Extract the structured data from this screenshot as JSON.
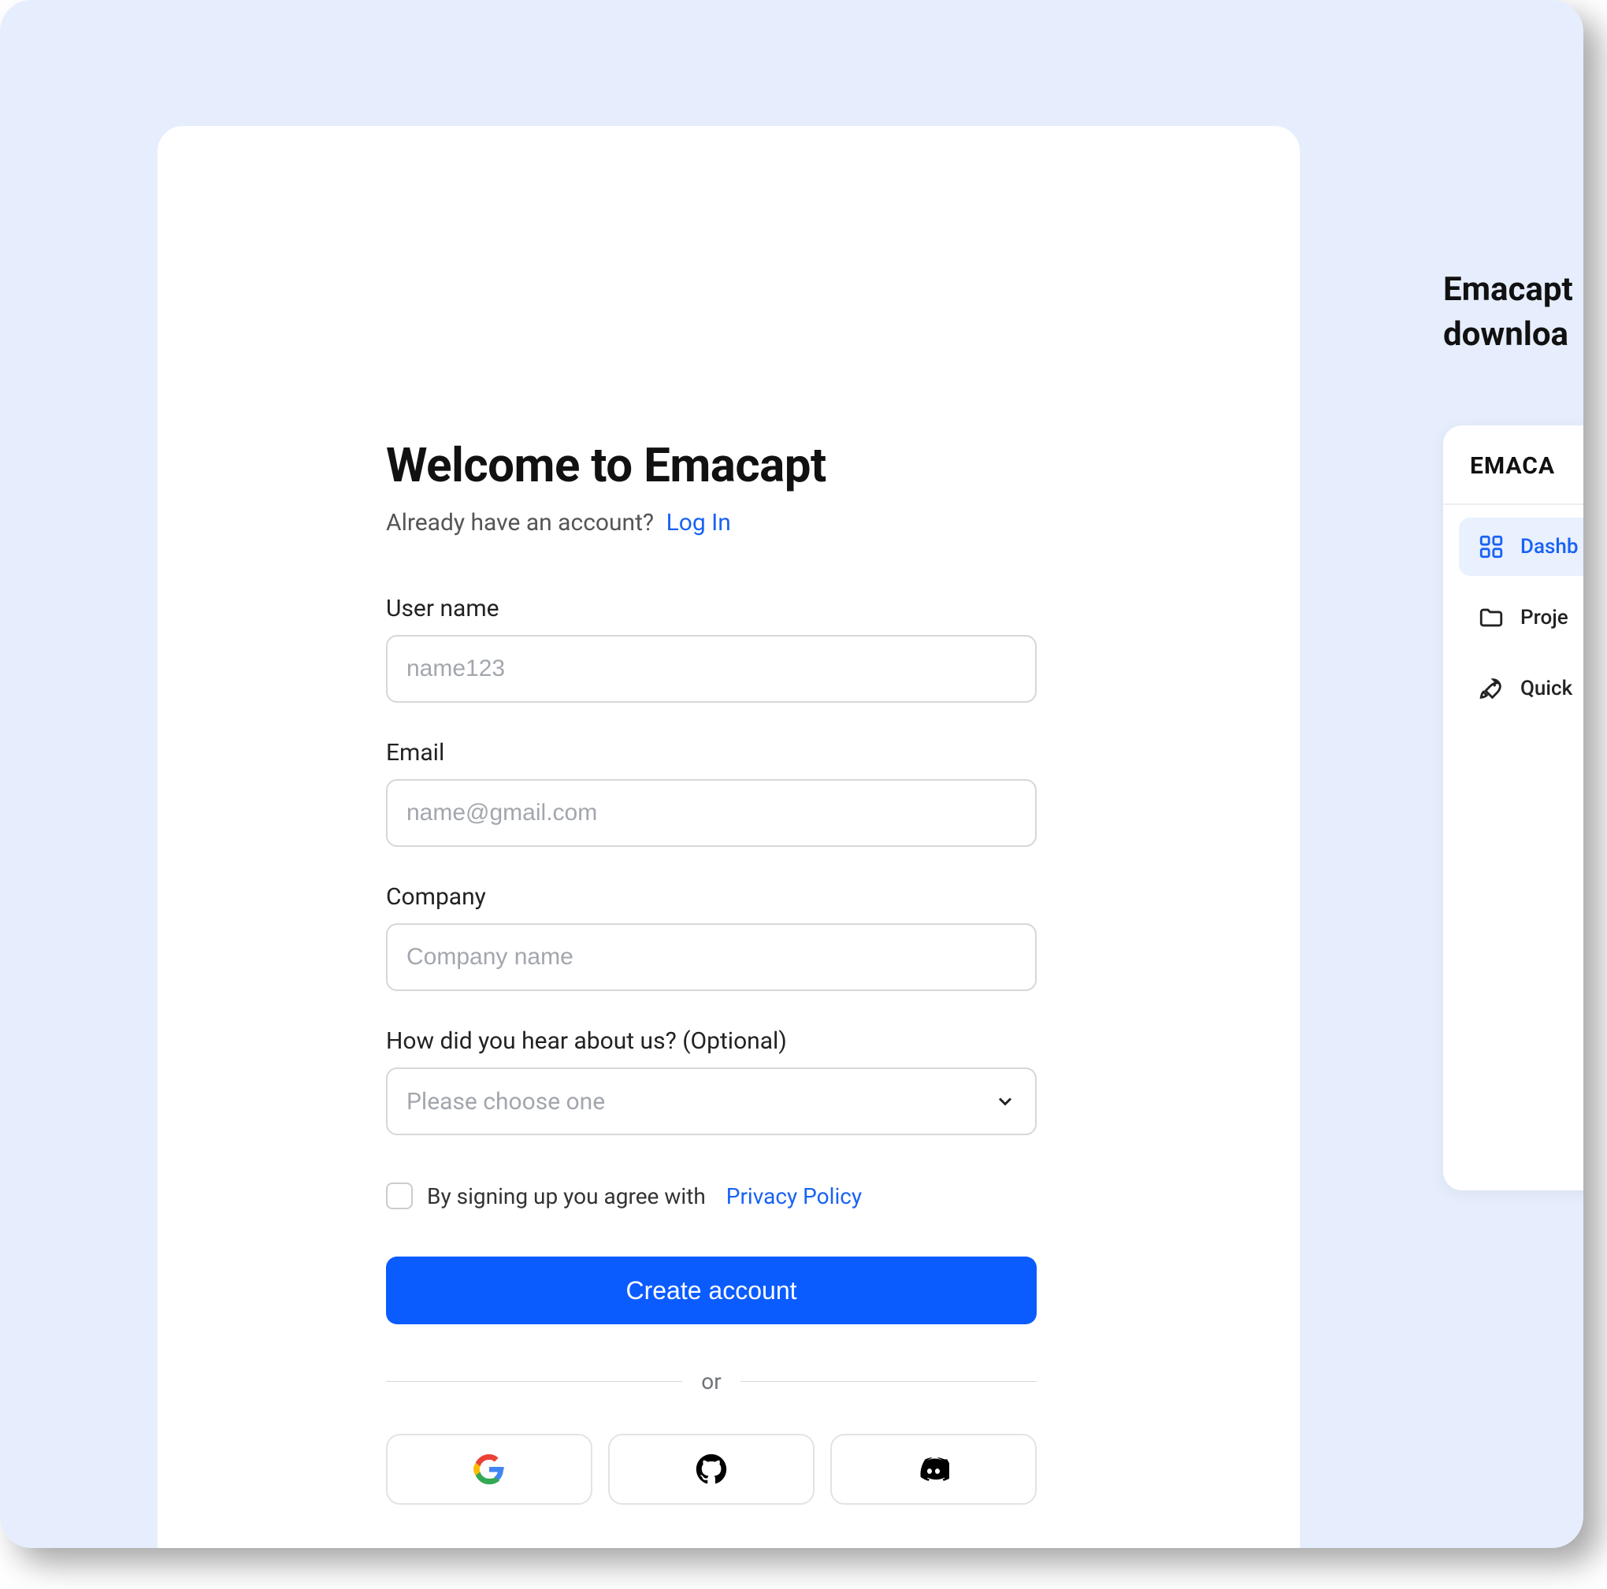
{
  "signup": {
    "title": "Welcome to Emacapt",
    "already": "Already have an account?",
    "login": "Log In",
    "fields": {
      "username_label": "User name",
      "username_placeholder": "name123",
      "email_label": "Email",
      "email_placeholder": "name@gmail.com",
      "company_label": "Company",
      "company_placeholder": "Company name",
      "heard_label": "How did you hear about us? (Optional)",
      "heard_placeholder": "Please choose one"
    },
    "consent_text": "By signing up you agree with",
    "privacy": "Privacy Policy",
    "create": "Create account",
    "or": "or"
  },
  "aside": {
    "title_line1": "Emacapt",
    "title_line2": "downloa",
    "brand": "EMACA",
    "nav": {
      "dashboard": "Dashb",
      "projects": "Proje",
      "quick": "Quick"
    }
  }
}
